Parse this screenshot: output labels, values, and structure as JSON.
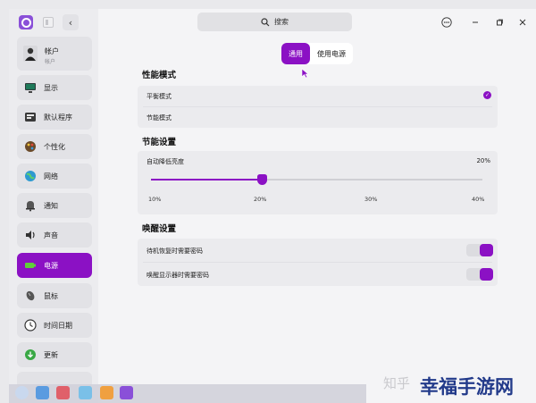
{
  "sidebar": {
    "account": {
      "name": "帐户",
      "sub": "帐户"
    },
    "items": [
      {
        "label": "显示",
        "icon": "monitor-icon"
      },
      {
        "label": "默认程序",
        "icon": "default-apps-icon"
      },
      {
        "label": "个性化",
        "icon": "palette-icon"
      },
      {
        "label": "网络",
        "icon": "globe-icon"
      },
      {
        "label": "通知",
        "icon": "bell-icon"
      },
      {
        "label": "声音",
        "icon": "speaker-icon"
      },
      {
        "label": "电源",
        "icon": "battery-icon",
        "active": true
      },
      {
        "label": "鼠标",
        "icon": "mouse-icon"
      },
      {
        "label": "时间日期",
        "icon": "clock-icon"
      },
      {
        "label": "更新",
        "icon": "update-icon"
      }
    ]
  },
  "header": {
    "search_placeholder": "搜索"
  },
  "tabs": [
    {
      "label": "通用",
      "active": true
    },
    {
      "label": "使用电源",
      "active": false
    }
  ],
  "performance": {
    "title": "性能模式",
    "options": [
      {
        "label": "平衡模式",
        "selected": true
      },
      {
        "label": "节能模式",
        "selected": false
      }
    ]
  },
  "power_saving": {
    "title": "节能设置",
    "auto_brightness_label": "自动降低亮度",
    "auto_brightness_value": "20%",
    "slider_value_percent": 20,
    "ticks": [
      "10%",
      "20%",
      "30%",
      "40%"
    ]
  },
  "wakeup": {
    "title": "唤醒设置",
    "items": [
      {
        "label": "待机恢复时需要密码",
        "on": true
      },
      {
        "label": "唤醒显示器时需要密码",
        "on": true
      }
    ]
  },
  "watermark": {
    "left": "知乎",
    "right": "幸福手游网"
  },
  "colors": {
    "accent": "#8b11c4",
    "sidebar": "#ececef",
    "background": "#f4f4f6"
  }
}
